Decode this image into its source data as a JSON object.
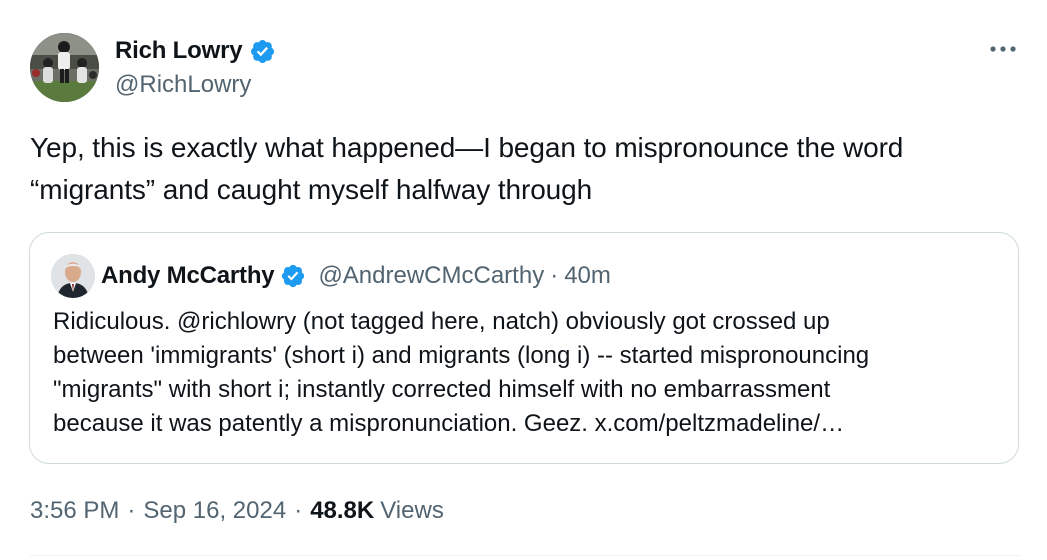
{
  "author": {
    "display_name": "Rich Lowry",
    "handle": "@RichLowry",
    "verified": true,
    "avatar_icon": "football-players-photo"
  },
  "tweet": {
    "lines": [
      "Yep, this is exactly what happened—I began to mispronounce the word",
      "“migrants” and caught myself halfway through"
    ]
  },
  "quote": {
    "display_name": "Andy McCarthy",
    "handle": "@AndrewCMcCarthy",
    "separator": "·",
    "time": "40m",
    "verified": true,
    "avatar_icon": "man-in-suit-photo",
    "lines": [
      "Ridiculous. @richlowry (not tagged here, natch) obviously got crossed up",
      "between 'immigrants' (short i) and migrants (long i) -- started mispronouncing",
      "\"migrants\" with short i; instantly corrected himself with no embarrassment",
      "because it was patently a mispronunciation. Geez. x.com/peltzmadeline/…"
    ]
  },
  "meta": {
    "time": "3:56 PM",
    "sep1": "·",
    "date": "Sep 16, 2024",
    "sep2": "·",
    "views_count": "48.8K",
    "views_label": "Views"
  },
  "icons": {
    "verified": "verified-badge-icon",
    "more": "more-options-icon"
  },
  "colors": {
    "verified_blue": "#1d9bf0",
    "text_primary": "#0f1419",
    "text_secondary": "#536471",
    "border": "#cfd9de"
  }
}
